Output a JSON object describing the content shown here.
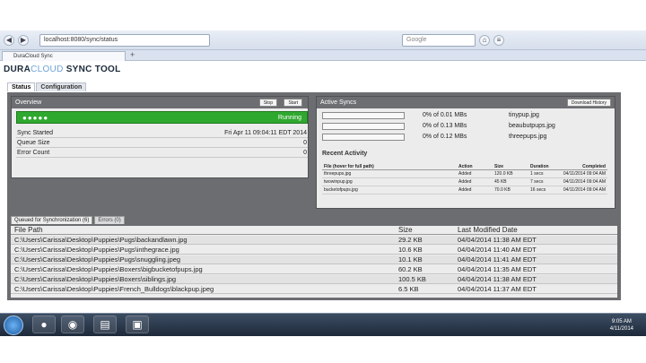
{
  "browser": {
    "url": "localhost:8080/sync/status",
    "search_placeholder": "Google",
    "tab_title": "DuraCloud Sync",
    "new_tab": "+"
  },
  "app": {
    "logo": {
      "dura": "DURA",
      "cloud": "CLOUD",
      "tool": " SYNC TOOL"
    },
    "tabs": [
      {
        "label": "Status",
        "active": true
      },
      {
        "label": "Configuration",
        "active": false
      }
    ]
  },
  "overview": {
    "title": "Overview",
    "stop_label": "Stop",
    "start_label": "Start",
    "status_text": "Running",
    "status_color": "#2fa82f",
    "rows": [
      {
        "key": "Sync Started",
        "value": "Fri Apr 11 09:04:11 EDT 2014"
      },
      {
        "key": "Queue Size",
        "value": "0"
      },
      {
        "key": "Error Count",
        "value": "0"
      }
    ]
  },
  "active_syncs": {
    "title": "Active Syncs",
    "download_history_label": "Download History",
    "items": [
      {
        "progress": 0.0,
        "pct_text": "0% of 0.01 MBs",
        "file": "tinypup.jpg"
      },
      {
        "progress": 0.0,
        "pct_text": "0% of 0.13 MBs",
        "file": "beaubutpups.jpg"
      },
      {
        "progress": 0.0,
        "pct_text": "0% of 0.12 MBs",
        "file": "threepups.jpg"
      }
    ],
    "recent_title": "Recent Activity",
    "recent_headers": {
      "file": "File (hover for full path)",
      "action": "Action",
      "size": "Size",
      "duration": "Duration",
      "completed": "Completed"
    },
    "recent_rows": [
      {
        "file": "threepups.jpg",
        "action": "Added",
        "size": "120.0 KB",
        "duration": "1 secs",
        "completed": "04/11/2014 09:04 AM"
      },
      {
        "file": "twowinpup.jpg",
        "action": "Added",
        "size": "45 KB",
        "duration": "7 secs",
        "completed": "04/11/2014 09:04 AM"
      },
      {
        "file": "bucketofpups.jpg",
        "action": "Added",
        "size": "70.0 KB",
        "duration": "16 secs",
        "completed": "04/11/2014 09:04 AM"
      }
    ]
  },
  "queue": {
    "tabs": [
      {
        "label": "Queued for Synchronization (6)",
        "active": true
      },
      {
        "label": "Errors (0)",
        "active": false
      }
    ],
    "headers": {
      "path": "File Path",
      "size": "Size",
      "modified": "Last Modified Date"
    },
    "rows": [
      {
        "path": "C:\\Users\\Carissa\\Desktop\\Puppies\\Pugs\\backandlawn.jpg",
        "size": "29.2 KB",
        "modified": "04/04/2014 11:38 AM EDT"
      },
      {
        "path": "C:\\Users\\Carissa\\Desktop\\Puppies\\Pugs\\inthegrace.jpg",
        "size": "10.6 KB",
        "modified": "04/04/2014 11:40 AM EDT"
      },
      {
        "path": "C:\\Users\\Carissa\\Desktop\\Puppies\\Pugs\\snuggling.jpeg",
        "size": "10.1 KB",
        "modified": "04/04/2014 11:41 AM EDT"
      },
      {
        "path": "C:\\Users\\Carissa\\Desktop\\Puppies\\Boxers\\bigbucketofpups.jpg",
        "size": "60.2 KB",
        "modified": "04/04/2014 11:35 AM EDT"
      },
      {
        "path": "C:\\Users\\Carissa\\Desktop\\Puppies\\Boxers\\siblings.jpg",
        "size": "100.5 KB",
        "modified": "04/04/2014 11:38 AM EDT"
      },
      {
        "path": "C:\\Users\\Carissa\\Desktop\\Puppies\\French_Bulldogs\\blackpup.jpeg",
        "size": "6.5 KB",
        "modified": "04/04/2014 11:37 AM EDT"
      }
    ]
  },
  "taskbar": {
    "time": "9:05 AM",
    "date": "4/11/2014",
    "apps": [
      "firefox-icon",
      "chrome-icon",
      "folder-icon",
      "app-icon"
    ]
  }
}
